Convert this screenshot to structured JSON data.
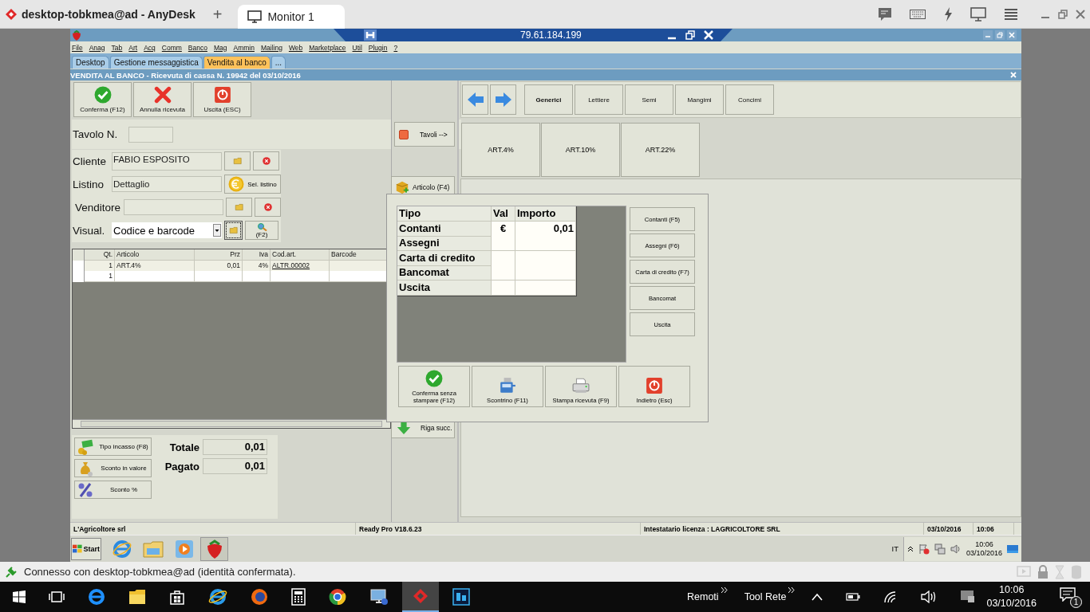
{
  "anydesk": {
    "title": "desktop-tobkmea@ad - AnyDesk",
    "new_tab": "+",
    "tabs": [
      {
        "label": "Monitor 1",
        "selected": true
      }
    ],
    "address": "79.61.184.199",
    "status": "Connesso con desktop-tobkmea@ad (identità confermata)."
  },
  "app": {
    "menu": [
      "File",
      "Anag",
      "Tab",
      "Art",
      "Acq",
      "Comm",
      "Banco",
      "Mag",
      "Ammin",
      "Mailing",
      "Web",
      "Marketplace",
      "Util",
      "Plugin",
      "?"
    ],
    "tabs": [
      {
        "label": "Desktop",
        "selected": false
      },
      {
        "label": "Gestione messaggistica",
        "selected": false
      },
      {
        "label": "Vendita al banco",
        "selected": true
      },
      {
        "label": "...",
        "selected": false
      }
    ],
    "form_title": "VENDITA AL BANCO - Ricevuta di cassa N. 19942 del 03/10/2016",
    "toolbar": [
      {
        "label": "Conferma (F12)",
        "kind": "check"
      },
      {
        "label": "Annulla ricevuta",
        "kind": "cross"
      },
      {
        "label": "Uscita (ESC)",
        "kind": "power"
      }
    ],
    "tavolo_label": "Tavolo N.",
    "tavoli_button": "Tavoli -->",
    "fields": [
      {
        "label": "Cliente",
        "value": "FABIO ESPOSITO",
        "kind": "lookup"
      },
      {
        "label": "Listino",
        "value": "Dettaglio",
        "kind": "listino",
        "button": "Sel. listino"
      },
      {
        "label": "Venditore",
        "kind": "lookup"
      }
    ],
    "visual": {
      "label": "Visual.",
      "value": "Codice e barcode",
      "button": "(F2)"
    },
    "grid": {
      "columns": [
        "Qt.",
        "Articolo",
        "Prz",
        "Iva",
        "Cod.art.",
        "Barcode"
      ],
      "rows": [
        {
          "cells": [
            "1",
            "ART.4%",
            "0,01",
            "4%",
            "ALTR.00002"
          ]
        },
        {
          "cells": [
            "1"
          ]
        }
      ]
    },
    "bottom_buttons": [
      {
        "label": "Tipo incasso (F8)",
        "kind": "money"
      },
      {
        "label": "Sconto in valore",
        "kind": "bag"
      },
      {
        "label": "Sconto %",
        "kind": "percent"
      }
    ],
    "totals": [
      {
        "label": "Totale",
        "value": "0,01"
      },
      {
        "label": "Pagato",
        "value": "0,01"
      }
    ],
    "side_buttons": [
      {
        "label": "Articolo (F4)",
        "kind": "box"
      },
      {
        "label": "Riga succ.",
        "kind": "down"
      }
    ],
    "categories": [
      {
        "label": "Generici",
        "selected": true
      },
      {
        "label": "Lettiere",
        "selected": false
      },
      {
        "label": "Semi",
        "selected": false
      },
      {
        "label": "Mangimi",
        "selected": false
      },
      {
        "label": "Concimi",
        "selected": false
      }
    ],
    "tiles": [
      "ART.4%",
      "ART.10%",
      "ART.22%"
    ],
    "status_bar": [
      "L'Agricoltore srl",
      "Ready Pro V18.6.23",
      "Intestatario licenza : LAGRICOLTORE SRL",
      "03/10/2016",
      "10:06"
    ]
  },
  "payment_dialog": {
    "columns": [
      "Tipo",
      "Val",
      "Importo"
    ],
    "rows": [
      {
        "tipo": "Contanti",
        "val": "€",
        "importo": "0,01"
      },
      {
        "tipo": "Assegni"
      },
      {
        "tipo": "Carta di credito"
      },
      {
        "tipo": "Bancomat"
      },
      {
        "tipo": "Uscita"
      }
    ],
    "buttons": [
      "Contanti (F5)",
      "Assegni (F6)",
      "Carta di credito (F7)",
      "Bancomat",
      "Uscita"
    ],
    "actions": [
      {
        "label": "Conferma senza stampare (F12)",
        "kind": "check"
      },
      {
        "label": "Scontrino (F11)",
        "kind": "register"
      },
      {
        "label": "Stampa ricevuta (F9)",
        "kind": "printer"
      },
      {
        "label": "Indietro (Esc)",
        "kind": "power"
      }
    ]
  },
  "remote_taskbar": {
    "start": "Start",
    "language": "IT",
    "time": "10:06",
    "date": "03/10/2016"
  },
  "windows_taskbar": {
    "toolbars": [
      "Remoti",
      "Tool Rete"
    ],
    "time": "10:06",
    "date": "03/10/2016",
    "notifications": "1"
  }
}
